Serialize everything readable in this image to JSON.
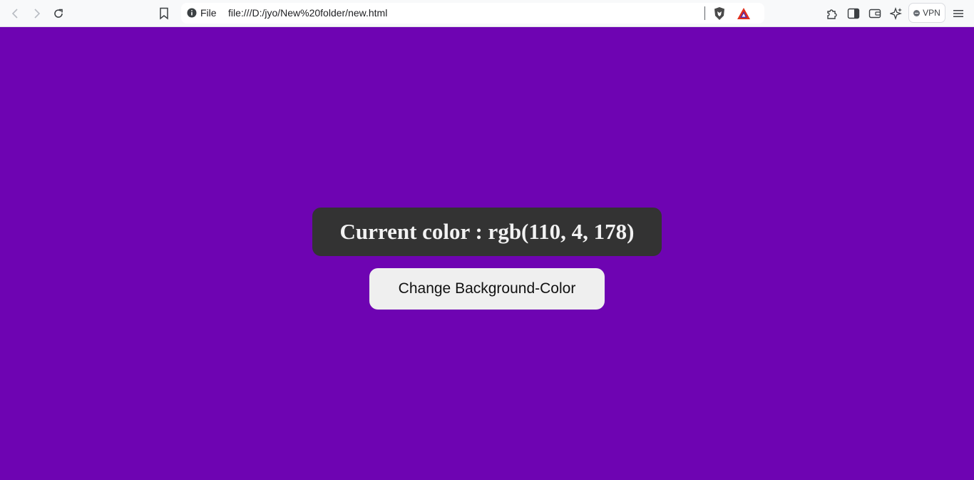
{
  "browser": {
    "address": {
      "scheme_label": "File",
      "url": "file:///D:/jyo/New%20folder/new.html"
    },
    "vpn_label": "VPN",
    "icons": [
      "back-icon",
      "forward-icon",
      "reload-icon",
      "bookmark-icon",
      "info-icon",
      "brave-shields-icon",
      "brave-rewards-icon",
      "extensions-icon",
      "sidebar-icon",
      "wallet-icon",
      "leo-ai-icon",
      "menu-icon"
    ]
  },
  "page": {
    "background_color": "#6e04b2",
    "color_label": "Current color : rgb(110, 4, 178)",
    "button_label": "Change Background-Color"
  }
}
